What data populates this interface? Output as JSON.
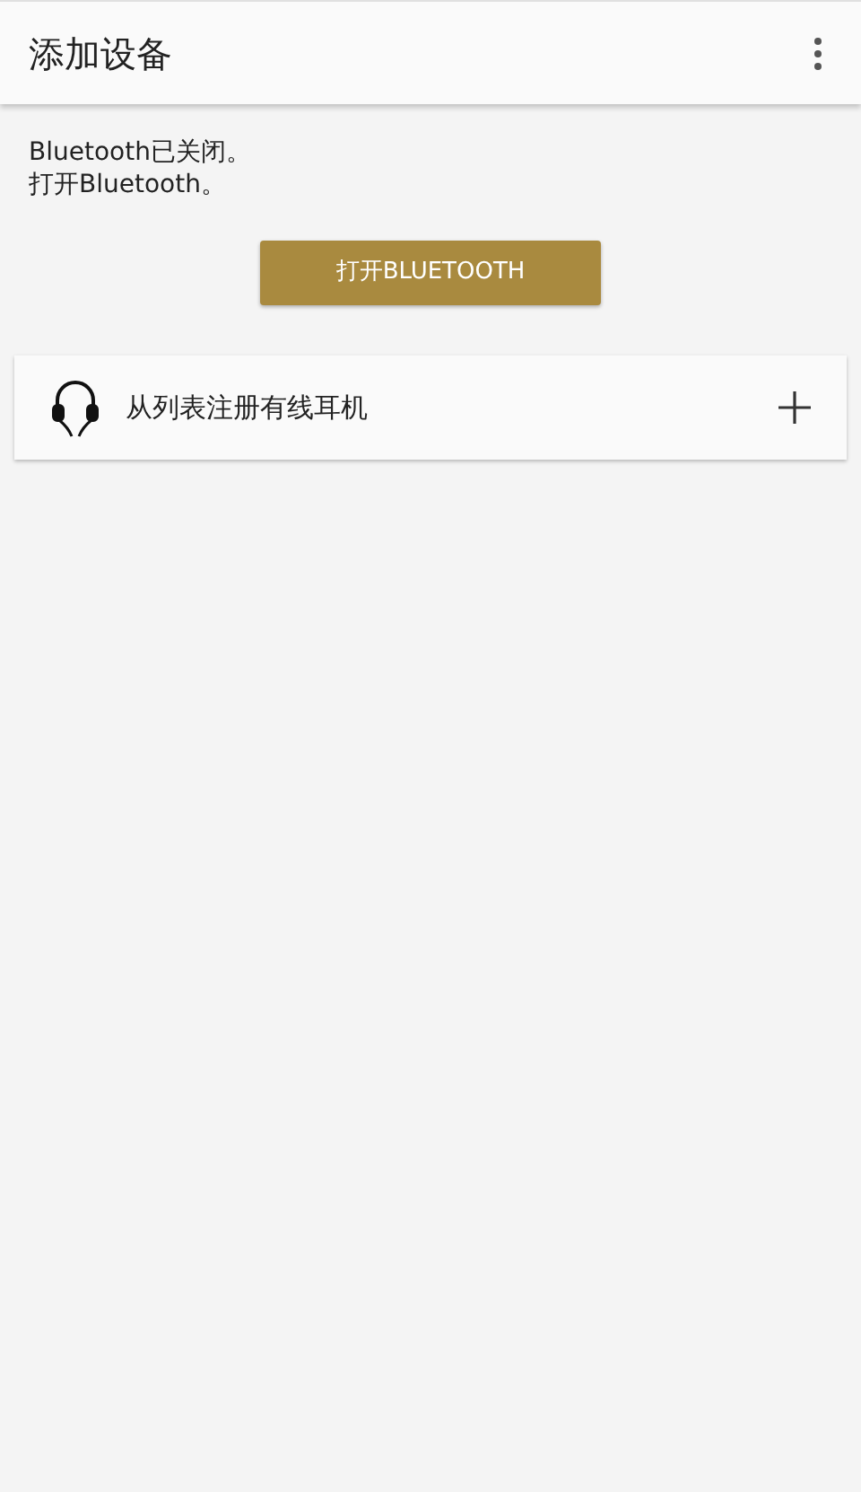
{
  "app_bar": {
    "title": "添加设备"
  },
  "message": [
    "Bluetooth已关闭。",
    "打开Bluetooth。"
  ],
  "enable_button": {
    "label": "打开BLUETOOTH"
  },
  "options": [
    {
      "label": "从列表注册有线耳机"
    }
  ]
}
